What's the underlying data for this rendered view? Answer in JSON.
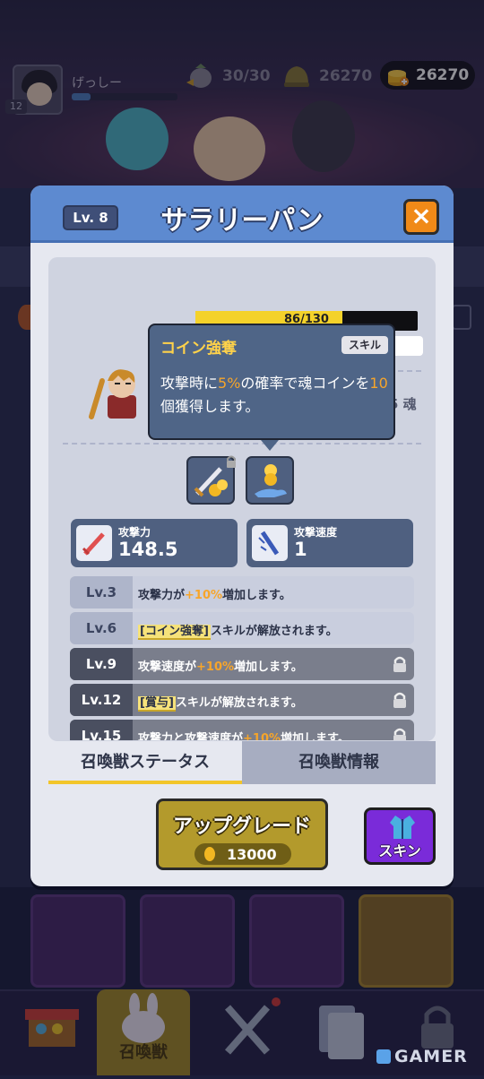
{
  "hud": {
    "player_name": "げっしー",
    "player_level": "12",
    "stamina": "30/30",
    "souls": "26270",
    "coins": "26270"
  },
  "modal": {
    "level_badge": "Lv. 8",
    "title": "サラリーパン",
    "close_icon": "×",
    "exp_text": "86/130",
    "exp_fraction": 0.66,
    "soul_suffix": "5 魂",
    "tooltip": {
      "title": "コイン強奪",
      "tag": "スキル",
      "body_pre": "攻撃時に",
      "body_pct": "5%",
      "body_mid": "の確率で魂コインを",
      "body_num": "10",
      "body_post": "個獲得します。"
    },
    "stats": [
      {
        "label": "攻撃力",
        "value": "148.5",
        "icon": "sword-icon"
      },
      {
        "label": "攻撃速度",
        "value": "1",
        "icon": "speed-blade-icon"
      }
    ],
    "level_rows": [
      {
        "lv": "Lv.3",
        "pre": "攻撃力が",
        "hl": "+10%",
        "post": "増加します。",
        "locked": false
      },
      {
        "lv": "Lv.6",
        "skill": "[コイン強奪]",
        "post": "スキルが解放されます。",
        "locked": false
      },
      {
        "lv": "Lv.9",
        "pre": "攻撃速度が",
        "hl": "+10%",
        "post": "増加します。",
        "locked": true
      },
      {
        "lv": "Lv.12",
        "skill": "[賞与]",
        "post": "スキルが解放されます。",
        "locked": true
      },
      {
        "lv": "Lv.15",
        "pre": "攻撃力と攻撃速度が",
        "hl": "+10%",
        "post": "増加します。",
        "locked": true
      }
    ],
    "tabs": {
      "status": "召喚獣ステータス",
      "info": "召喚獣情報"
    },
    "upgrade": {
      "label": "アップグレード",
      "cost": "13000"
    },
    "skin": {
      "label": "スキン"
    }
  },
  "bottom_nav": {
    "active_label": "召喚獣"
  },
  "watermark": "GAMER",
  "colors": {
    "header": "#5d8ad0",
    "highlight": "#f7a52a",
    "upgrade": "#b39a2c",
    "skin": "#7a2bd9",
    "close": "#f08a18"
  }
}
